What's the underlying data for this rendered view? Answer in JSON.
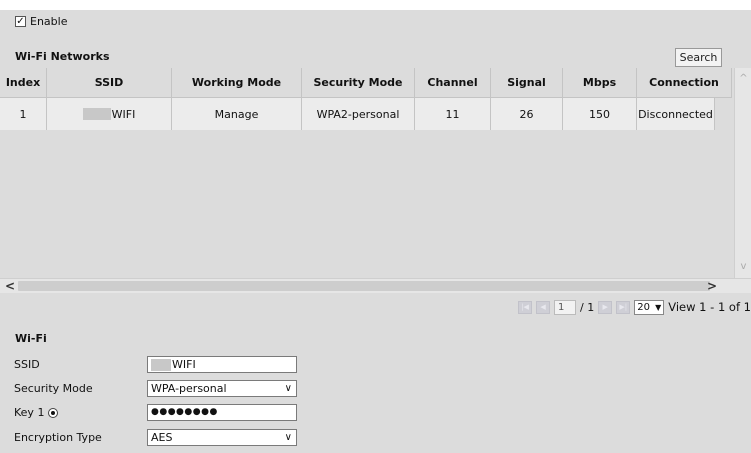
{
  "enable": {
    "label": "Enable",
    "checked": true,
    "check_glyph": "✓"
  },
  "networks": {
    "title": "Wi-Fi Networks",
    "search_label": "Search",
    "columns": [
      "Index",
      "SSID",
      "Working Mode",
      "Security Mode",
      "Channel",
      "Signal",
      "Mbps",
      "Connection"
    ],
    "rows": [
      {
        "index": "1",
        "ssid": "WIFI",
        "working_mode": "Manage",
        "security_mode": "WPA2-personal",
        "channel": "11",
        "signal": "26",
        "mbps": "150",
        "connection": "Disconnected"
      }
    ]
  },
  "pager": {
    "page_value": "1",
    "page_total": "/ 1",
    "page_size": "20",
    "view_text": "View 1 - 1 of 1",
    "first_icon": "first-page-icon",
    "prev_icon": "prev-page-icon",
    "next_icon": "next-page-icon",
    "last_icon": "last-page-icon"
  },
  "wifi": {
    "title": "Wi-Fi",
    "ssid_label": "SSID",
    "ssid_value": "WIFI",
    "security_label": "Security Mode",
    "security_value": "WPA-personal",
    "key_label": "Key 1",
    "key_value": "●●●●●●●●",
    "encryption_label": "Encryption Type",
    "encryption_value": "AES"
  },
  "glyphs": {
    "left": "<",
    "right": ">",
    "up": "^",
    "down": "v",
    "caret": "▼"
  },
  "colors": {
    "panel": "#dcdcdc",
    "row": "#ececec",
    "border": "#c4c4c4"
  }
}
